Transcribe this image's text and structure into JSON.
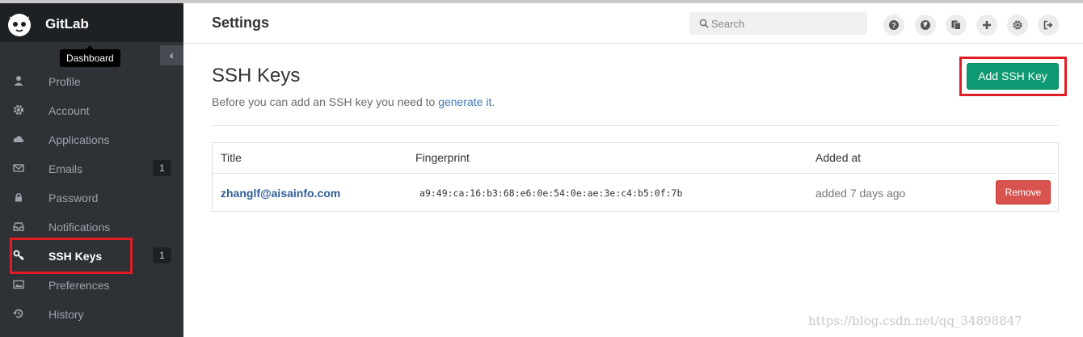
{
  "app": {
    "name": "GitLab"
  },
  "sidebar": {
    "tooltip": "Dashboard",
    "collapse_icon": "chevron-left-icon",
    "items": [
      {
        "label": "Profile",
        "icon": "user-icon",
        "badge": ""
      },
      {
        "label": "Account",
        "icon": "gear-icon",
        "badge": ""
      },
      {
        "label": "Applications",
        "icon": "cloud-icon",
        "badge": ""
      },
      {
        "label": "Emails",
        "icon": "envelope-icon",
        "badge": "1"
      },
      {
        "label": "Password",
        "icon": "lock-icon",
        "badge": ""
      },
      {
        "label": "Notifications",
        "icon": "inbox-icon",
        "badge": ""
      },
      {
        "label": "SSH Keys",
        "icon": "key-icon",
        "badge": "1",
        "active": true
      },
      {
        "label": "Preferences",
        "icon": "image-icon",
        "badge": ""
      },
      {
        "label": "History",
        "icon": "history-icon",
        "badge": ""
      }
    ]
  },
  "header": {
    "title": "Settings",
    "search_placeholder": "Search"
  },
  "content": {
    "title": "SSH Keys",
    "description_prefix": "Before you can add an SSH key you need to ",
    "description_link": "generate it",
    "description_suffix": ".",
    "add_button": "Add SSH Key"
  },
  "table": {
    "headers": [
      "Title",
      "Fingerprint",
      "Added at"
    ],
    "rows": [
      {
        "title": "zhanglf@aisainfo.com",
        "fingerprint": "a9:49:ca:16:b3:68:e6:0e:54:0e:ae:3e:c4:b5:0f:7b",
        "added": "added 7 days ago",
        "action": "Remove"
      }
    ]
  },
  "watermark": "https://blog.csdn.net/qq_34898847",
  "colors": {
    "sidebar_bg": "#2e3136",
    "brand_bg": "#1e2124",
    "accent_green": "#0d9a73",
    "danger_red": "#d9534f",
    "highlight_red": "#e01c24",
    "link_blue": "#3c78b5"
  }
}
